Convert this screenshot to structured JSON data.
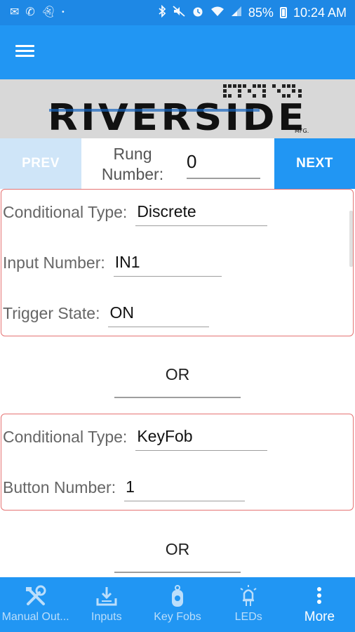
{
  "status_bar": {
    "battery": "85%",
    "time": "10:24 AM",
    "left_icons": [
      "email-icon",
      "call-icon",
      "snapchat-icon",
      "dot-icon"
    ],
    "right_icons": [
      "bluetooth-icon",
      "mute-icon",
      "alarm-icon",
      "wifi-icon",
      "signal-icon",
      "battery-icon"
    ]
  },
  "app_bar": {
    "menu_icon": "hamburger-menu-icon",
    "color": "#2196f3"
  },
  "logo": {
    "text": "RIVERSIDE",
    "suffix": "MFG."
  },
  "rung": {
    "prev_label": "PREV",
    "next_label": "NEXT",
    "label": "Rung Number:",
    "value": "0"
  },
  "conditions": [
    {
      "fields": [
        {
          "label": "Conditional Type:",
          "value": "Discrete"
        },
        {
          "label": "Input Number:",
          "value": "IN1"
        },
        {
          "label": "Trigger State:",
          "value": "ON"
        }
      ]
    },
    {
      "fields": [
        {
          "label": "Conditional Type:",
          "value": "KeyFob"
        },
        {
          "label": "Button Number:",
          "value": "1"
        }
      ]
    }
  ],
  "or_label": "OR",
  "bottom_nav": [
    {
      "label": "Manual Out...",
      "icon": "tools-icon",
      "active": false
    },
    {
      "label": "Inputs",
      "icon": "download-tray-icon",
      "active": false
    },
    {
      "label": "Key Fobs",
      "icon": "key-fob-icon",
      "active": false
    },
    {
      "label": "LEDs",
      "icon": "led-bulb-icon",
      "active": false
    },
    {
      "label": "More",
      "icon": "more-vertical-icon",
      "active": true
    }
  ],
  "colors": {
    "primary": "#2196f3",
    "status_bar": "#1e88e5",
    "card_border": "#e57373",
    "prev_disabled": "#cfe5f8"
  }
}
